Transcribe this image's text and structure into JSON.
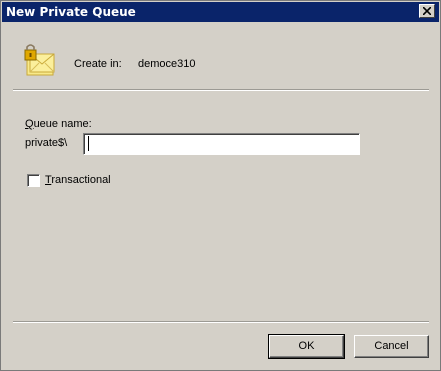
{
  "window": {
    "title": "New Private Queue",
    "close_glyph": "✕"
  },
  "header": {
    "icon": "locked-envelope-icon",
    "create_in_label": "Create in:",
    "create_in_value": "democe310"
  },
  "form": {
    "queue_name_label_accel": "Q",
    "queue_name_label_rest": "ueue name:",
    "prefix": "private$\\",
    "queue_name_value": "",
    "transactional_accel": "T",
    "transactional_rest": "ransactional",
    "transactional_checked": false
  },
  "buttons": {
    "ok": "OK",
    "cancel": "Cancel"
  },
  "colors": {
    "titlebar": "#0a246a",
    "dialog_bg": "#d4d0c8"
  }
}
